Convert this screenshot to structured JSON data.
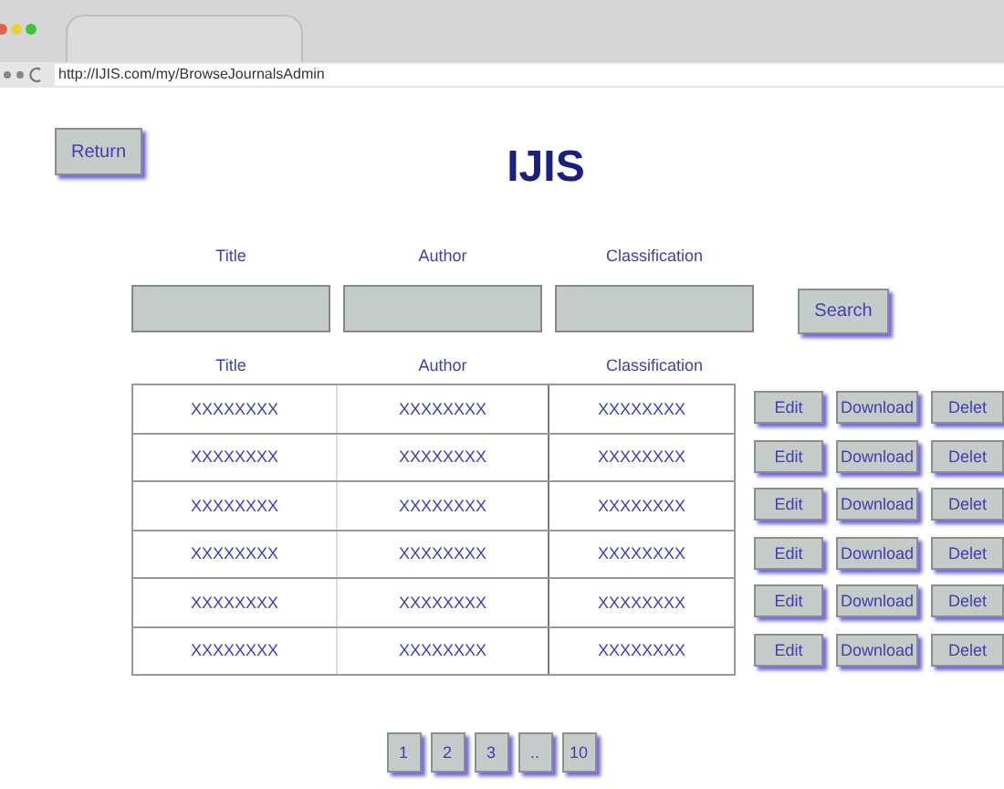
{
  "browser": {
    "url": "http://IJIS.com/my/BrowseJournalsAdmin"
  },
  "return_button": "Return",
  "title": "IJIS",
  "search": {
    "fields": [
      {
        "label": "Title"
      },
      {
        "label": "Author"
      },
      {
        "label": "Classification"
      }
    ],
    "button": "Search"
  },
  "table": {
    "columns": [
      "Title",
      "Author",
      "Classification"
    ],
    "rows": [
      {
        "cells": [
          "XXXXXXXX",
          "XXXXXXXX",
          "XXXXXXXX"
        ],
        "actions": [
          "Edit",
          "Download",
          "Delet"
        ]
      },
      {
        "cells": [
          "XXXXXXXX",
          "XXXXXXXX",
          "XXXXXXXX"
        ],
        "actions": [
          "Edit",
          "Download",
          "Delet"
        ]
      },
      {
        "cells": [
          "XXXXXXXX",
          "XXXXXXXX",
          "XXXXXXXX"
        ],
        "actions": [
          "Edit",
          "Download",
          "Delet"
        ]
      },
      {
        "cells": [
          "XXXXXXXX",
          "XXXXXXXX",
          "XXXXXXXX"
        ],
        "actions": [
          "Edit",
          "Download",
          "Delet"
        ]
      },
      {
        "cells": [
          "XXXXXXXX",
          "XXXXXXXX",
          "XXXXXXXX"
        ],
        "actions": [
          "Edit",
          "Download",
          "Delet"
        ]
      },
      {
        "cells": [
          "XXXXXXXX",
          "XXXXXXXX",
          "XXXXXXXX"
        ],
        "actions": [
          "Edit",
          "Download",
          "Delet"
        ]
      }
    ]
  },
  "pagination": [
    {
      "label": "1"
    },
    {
      "label": "2"
    },
    {
      "label": "3"
    },
    {
      "label": ".."
    },
    {
      "label": "10"
    }
  ]
}
